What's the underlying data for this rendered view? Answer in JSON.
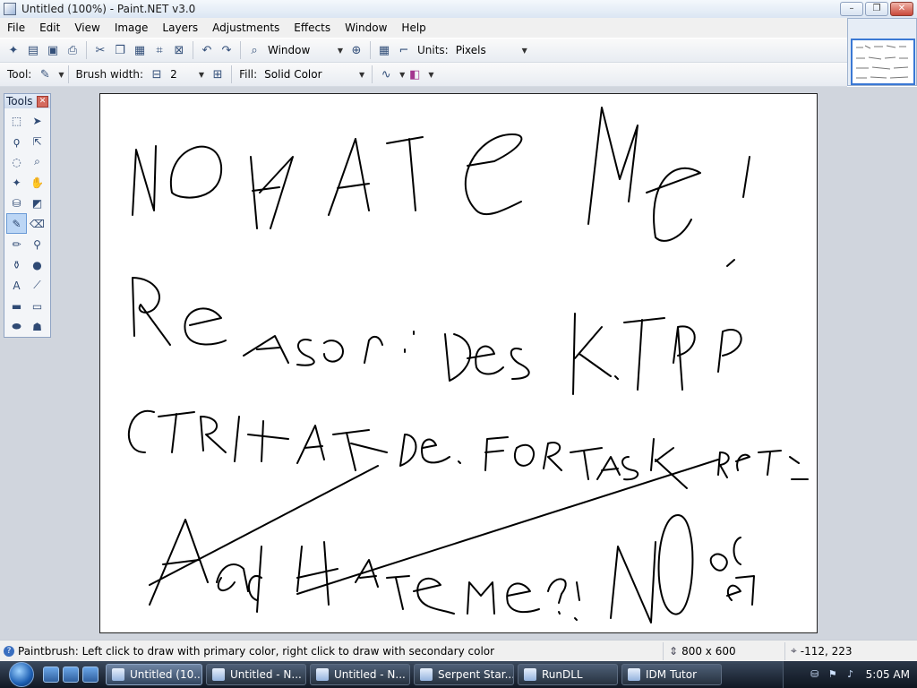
{
  "window": {
    "title": "Untitled (100%) - Paint.NET v3.0",
    "buttons": {
      "minimize": "–",
      "maximize": "❐",
      "close": "✕"
    }
  },
  "menu": [
    "File",
    "Edit",
    "View",
    "Image",
    "Layers",
    "Adjustments",
    "Effects",
    "Window",
    "Help"
  ],
  "toolbar": {
    "window_label": "Window",
    "units_label": "Units:",
    "units_value": "Pixels"
  },
  "tool_options": {
    "tool_label": "Tool:",
    "brush_width_label": "Brush width:",
    "brush_width_value": "2",
    "minus": "⊟",
    "plus": "⊞",
    "fill_label": "Fill:",
    "fill_value": "Solid Color"
  },
  "tools_panel": {
    "title": "Tools",
    "items": [
      {
        "name": "rectangle-select-tool",
        "glyph": "⬚"
      },
      {
        "name": "move-selection-tool",
        "glyph": "➤"
      },
      {
        "name": "lasso-select-tool",
        "glyph": "ϙ"
      },
      {
        "name": "move-selection-outline-tool",
        "glyph": "⇱"
      },
      {
        "name": "ellipse-select-tool",
        "glyph": "◌"
      },
      {
        "name": "zoom-tool",
        "glyph": "⌕"
      },
      {
        "name": "magic-wand-tool",
        "glyph": "✦"
      },
      {
        "name": "pan-tool",
        "glyph": "✋"
      },
      {
        "name": "paint-bucket-tool",
        "glyph": "⛁"
      },
      {
        "name": "gradient-tool",
        "glyph": "◩"
      },
      {
        "name": "paintbrush-tool",
        "glyph": "✎"
      },
      {
        "name": "eraser-tool",
        "glyph": "⌫"
      },
      {
        "name": "pencil-tool",
        "glyph": "✏"
      },
      {
        "name": "color-picker-tool",
        "glyph": "⚲"
      },
      {
        "name": "clone-stamp-tool",
        "glyph": "⚱"
      },
      {
        "name": "recolor-tool",
        "glyph": "●"
      },
      {
        "name": "text-tool",
        "glyph": "A"
      },
      {
        "name": "line-curve-tool",
        "glyph": "⟋"
      },
      {
        "name": "rectangle-tool",
        "glyph": "▬"
      },
      {
        "name": "rounded-rectangle-tool",
        "glyph": "▭"
      },
      {
        "name": "ellipse-tool",
        "glyph": "⬬"
      },
      {
        "name": "freeform-shape-tool",
        "glyph": "☗"
      }
    ]
  },
  "status": {
    "help": "Paintbrush: Left click to draw with primary color, right click to draw with secondary color",
    "image_size": "800 x 600",
    "cursor": "-112, 223"
  },
  "taskbar": {
    "tasks": [
      "Untitled (10...",
      "Untitled - N...",
      "Untitled - N...",
      "Serpent Star...",
      "RunDLL",
      "IDM Tutor"
    ],
    "active_index": 0,
    "clock": "5:05 AM"
  },
  "colors": {
    "accent": "#3a78d4",
    "canvas_bg": "#ffffff",
    "workspace_bg": "#d0d5dd"
  }
}
